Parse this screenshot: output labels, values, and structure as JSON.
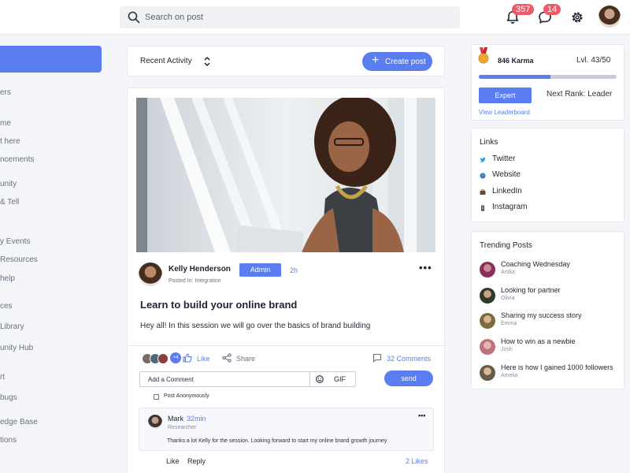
{
  "topbar": {
    "search_placeholder": "Search on post",
    "notifications_count": "357",
    "messages_count": "14"
  },
  "sidebar": {
    "items": [
      "ers",
      "me",
      "t here",
      "ncements",
      "unity",
      "& Tell",
      "y Events",
      "Resources",
      "help",
      "ces",
      "Library",
      "unity Hub",
      "rt",
      "bugs",
      "edge Base",
      "tions"
    ]
  },
  "feed": {
    "sort_label": "Recent Activity",
    "create_post_label": "Create post"
  },
  "post": {
    "author": "Kelly Henderson",
    "posted_in": "Posted In: Integration",
    "role_tag": "Admin",
    "time": "2h",
    "more": "•••",
    "title": "Learn to build your online brand",
    "body": "Hey all! In this session we will go over the basics of brand building",
    "reactor_count": "+4",
    "like_label": "Like",
    "share_label": "Share",
    "comments_label": "32 Comments",
    "comment_placeholder": "Add a Comment",
    "gif_label": "GIF",
    "send_label": "send",
    "anonymous_label": "Post Anonymously"
  },
  "comment": {
    "author": "Mark",
    "time": "32min",
    "role": "Researcher",
    "more": "•••",
    "text": "Thanks a lot Kelly for the session. Looking forward to start my online brand growth journey",
    "like_label": "Like",
    "reply_label": "Reply",
    "likes_count": "2 Likes"
  },
  "karma": {
    "label": "846 Karma",
    "level": "Lvl. 43/50",
    "progress": 0.52,
    "rank": "Expert",
    "next_rank": "Next Rank: Leader",
    "leaderboard_link": "View Leaderboard"
  },
  "links": {
    "title": "Links",
    "items": [
      {
        "label": "Twitter",
        "icon": "twitter-icon"
      },
      {
        "label": "Website",
        "icon": "globe-icon"
      },
      {
        "label": "LinkedIn",
        "icon": "linkedin-icon"
      },
      {
        "label": "Instagram",
        "icon": "instagram-icon"
      }
    ]
  },
  "trending": {
    "title": "Trending Posts",
    "items": [
      {
        "title": "Coaching Wednesday",
        "author": "Artika"
      },
      {
        "title": "Looking for partner",
        "author": "Olivia"
      },
      {
        "title": "Sharing my success story",
        "author": "Emma"
      },
      {
        "title": "How to win as a newbie",
        "author": "Josh"
      },
      {
        "title": "Here is how I gained 1000 followers",
        "author": "Amelia"
      }
    ]
  },
  "colors": {
    "accent": "#5b7df2",
    "badge": "#f05a68",
    "background": "#f4f5f9"
  }
}
